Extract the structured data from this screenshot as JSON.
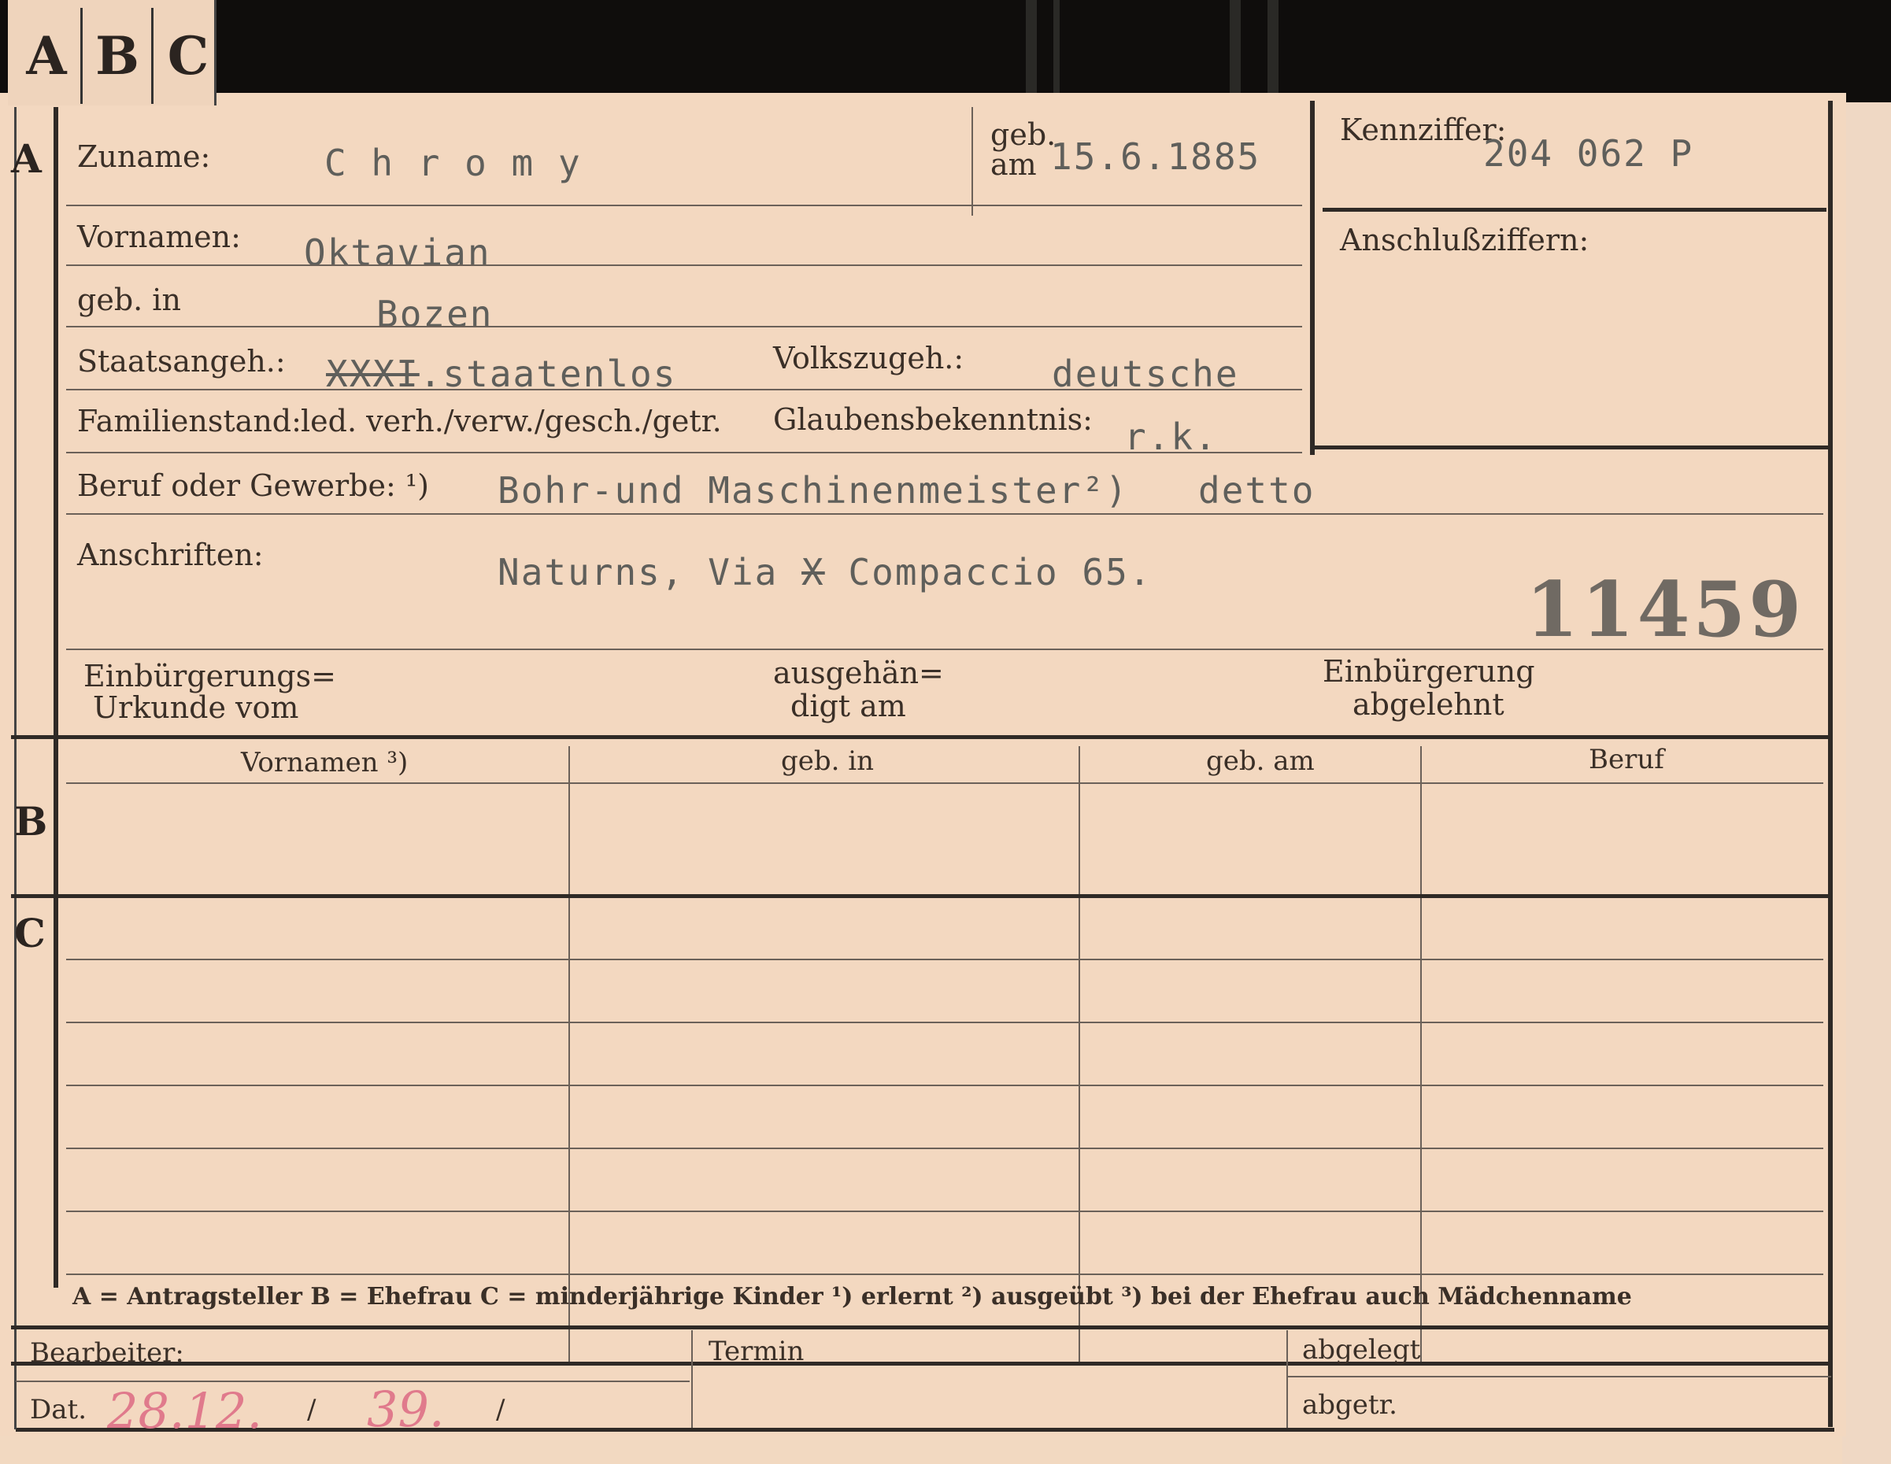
{
  "tabs": [
    "A",
    "B",
    "C"
  ],
  "section_markers": {
    "a": "A",
    "b": "B",
    "c": "C"
  },
  "section_a": {
    "surname_label": "Zuname:",
    "surname_value": "C h r o m y",
    "birth_date_label_1": "geb.",
    "birth_date_label_2": "am",
    "birth_date_value": "15.6.1885",
    "first_names_label": "Vornamen:",
    "first_names_value": "Oktavian",
    "birthplace_label": "geb. in",
    "birthplace_value": "Bozen",
    "citizenship_label": "Staatsangeh.:",
    "citizenship_struck": "XXXI",
    "citizenship_value": ".staatenlos",
    "ethnicity_label": "Volkszugeh.:",
    "ethnicity_value": "deutsche",
    "marital_status_label": "Familienstand:",
    "marital_status_options": "led. verh./verw./gesch./getr.",
    "religion_label": "Glaubensbekenntnis:",
    "religion_value": "r.k.",
    "occupation_label": "Beruf oder Gewerbe: ¹)",
    "occupation_value": "Bohr-und Maschinenmeister²)",
    "occupation_practiced": "detto",
    "address_label": "Anschriften:",
    "address_value_1": "Naturns, Via",
    "address_struck": "X",
    "address_value_2": "Compaccio 65.",
    "stamp_number": "11459",
    "naturalization_cert_label_1": "Einbürgerungs=",
    "naturalization_cert_label_2": "Urkunde vom",
    "handed_out_label_1": "ausgehän=",
    "handed_out_label_2": "digt am",
    "naturalization_refused_label_1": "Einbürgerung",
    "naturalization_refused_label_2": "abgelehnt"
  },
  "id_box": {
    "code_label": "Kennziffer:",
    "code_value": "204 062  P",
    "linked_codes_label": "Anschlußziffern:"
  },
  "family_table": {
    "headers": [
      "Vornamen ³)",
      "geb. in",
      "geb. am",
      "Beruf"
    ]
  },
  "legend": {
    "text": "A = Antragsteller   B = Ehefrau   C = minderjährige Kinder   ¹) erlernt   ²) ausgeübt   ³) bei der Ehefrau auch Mädchenname"
  },
  "footer": {
    "clerk_label": "Bearbeiter:",
    "date_label": "Dat.",
    "date_handwritten_1": "28.12.",
    "date_slash": "/",
    "date_handwritten_2": "39.",
    "deadline_label": "Termin",
    "filed_label": "abgelegt",
    "removed_label": "abgetr."
  }
}
